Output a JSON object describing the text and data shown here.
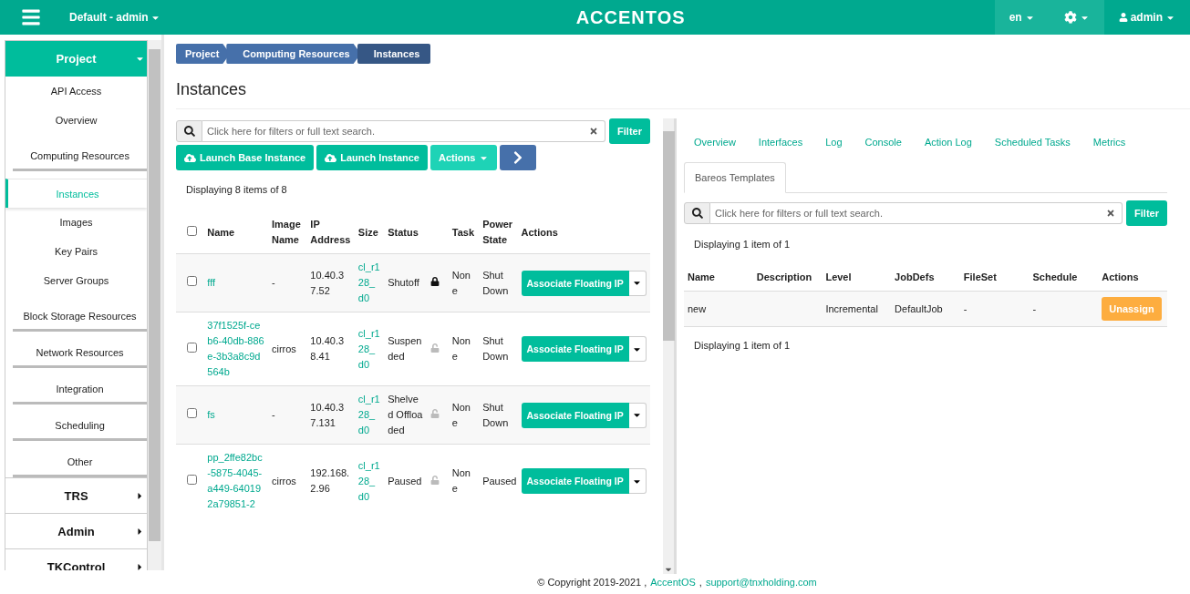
{
  "topbar": {
    "project_menu": "Default - admin",
    "logo": "ACCENTOS",
    "language": "en",
    "user": "admin"
  },
  "sidebar": {
    "sections": [
      {
        "label": "Project",
        "expanded": true,
        "children": [
          {
            "label": "API Access",
            "kind": "link",
            "selected": false
          },
          {
            "label": "Overview",
            "kind": "link",
            "selected": false
          },
          {
            "label": "Computing Resources",
            "kind": "group",
            "selected": false
          },
          {
            "label": "Instances",
            "kind": "link",
            "selected": true
          },
          {
            "label": "Images",
            "kind": "link",
            "selected": false
          },
          {
            "label": "Key Pairs",
            "kind": "link",
            "selected": false
          },
          {
            "label": "Server Groups",
            "kind": "link",
            "selected": false
          },
          {
            "label": "Block Storage Resources",
            "kind": "group",
            "selected": false
          },
          {
            "label": "Network Resources",
            "kind": "group",
            "selected": false
          },
          {
            "label": "Integration",
            "kind": "group",
            "selected": false
          },
          {
            "label": "Scheduling",
            "kind": "group",
            "selected": false
          },
          {
            "label": "Other",
            "kind": "group",
            "selected": false
          }
        ]
      },
      {
        "label": "TRS",
        "expanded": false
      },
      {
        "label": "Admin",
        "expanded": false
      },
      {
        "label": "TKControl",
        "expanded": false
      }
    ]
  },
  "breadcrumb": [
    {
      "label": "Project",
      "selected": false
    },
    {
      "label": "Computing Resources",
      "selected": false
    },
    {
      "label": "Instances",
      "selected": true
    }
  ],
  "page_title": "Instances",
  "instances": {
    "search": {
      "placeholder": "Click here for filters or full text search."
    },
    "filter_button": "Filter",
    "buttons": [
      {
        "label": "Launch Base Instance",
        "kind": "launch"
      },
      {
        "label": "Launch Instance",
        "kind": "launch"
      },
      {
        "label": "Actions",
        "kind": "dropdown"
      },
      {
        "kind": "next"
      }
    ],
    "select_all_checked": false,
    "count": "Displaying 8 items of 8",
    "columns": [
      "Name",
      "Image Name",
      "IP Address",
      "Size",
      "Status",
      "Task",
      "Power State",
      "Actions"
    ],
    "rows": [
      {
        "checked": false,
        "name": "fff",
        "image": "-",
        "ip": "10.40.37.52",
        "size": "cl_r128_d0",
        "status": "Shutoff",
        "locked": true,
        "task": "None",
        "power": "Shut Down",
        "action": "Associate Floating IP"
      },
      {
        "checked": false,
        "name": "37f1525f-ceb6-40db-886e-3b3a8c9d564b",
        "image": "cirros",
        "ip": "10.40.38.41",
        "size": "cl_r128_d0",
        "status": "Suspended",
        "locked": false,
        "task": "None",
        "power": "Shut Down",
        "action": "Associate Floating IP"
      },
      {
        "checked": false,
        "name": "fs",
        "image": "-",
        "ip": "10.40.37.131",
        "size": "cl_r128_d0",
        "status": "Shelved Offloaded",
        "locked": false,
        "task": "None",
        "power": "Shut Down",
        "action": "Associate Floating IP"
      },
      {
        "checked": false,
        "name": "pp_2ffe82bc-5875-4045-a449-640192a79851-2",
        "image": "cirros",
        "ip": "192.168.2.96",
        "size": "cl_r128_d0",
        "status": "Paused",
        "locked": false,
        "task": "None",
        "power": "Paused",
        "action": "Associate Floating IP"
      }
    ]
  },
  "detail": {
    "tabs": [
      {
        "label": "Overview",
        "selected": false
      },
      {
        "label": "Interfaces",
        "selected": false
      },
      {
        "label": "Log",
        "selected": false
      },
      {
        "label": "Console",
        "selected": false
      },
      {
        "label": "Action Log",
        "selected": false
      },
      {
        "label": "Scheduled Tasks",
        "selected": false
      },
      {
        "label": "Metrics",
        "selected": false
      },
      {
        "label": "Bareos Templates",
        "selected": true
      }
    ],
    "search": {
      "placeholder": "Click here for filters or full text search."
    },
    "filter_button": "Filter",
    "count_top": "Displaying 1 item of 1",
    "columns": [
      "Name",
      "Description",
      "Level",
      "JobDefs",
      "FileSet",
      "Schedule",
      "Actions"
    ],
    "rows": [
      {
        "name": "new",
        "level": "Incremental",
        "jobdefs": "DefaultJob",
        "fileset": "-",
        "schedule": "-",
        "action": "Unassign"
      }
    ],
    "count_bottom": "Displaying 1 item of 1"
  },
  "footer": {
    "prefix": "© Copyright 2019-2021 ,",
    "links": [
      "AccentOS",
      "support@tnxholding.com"
    ],
    "separator": ","
  }
}
